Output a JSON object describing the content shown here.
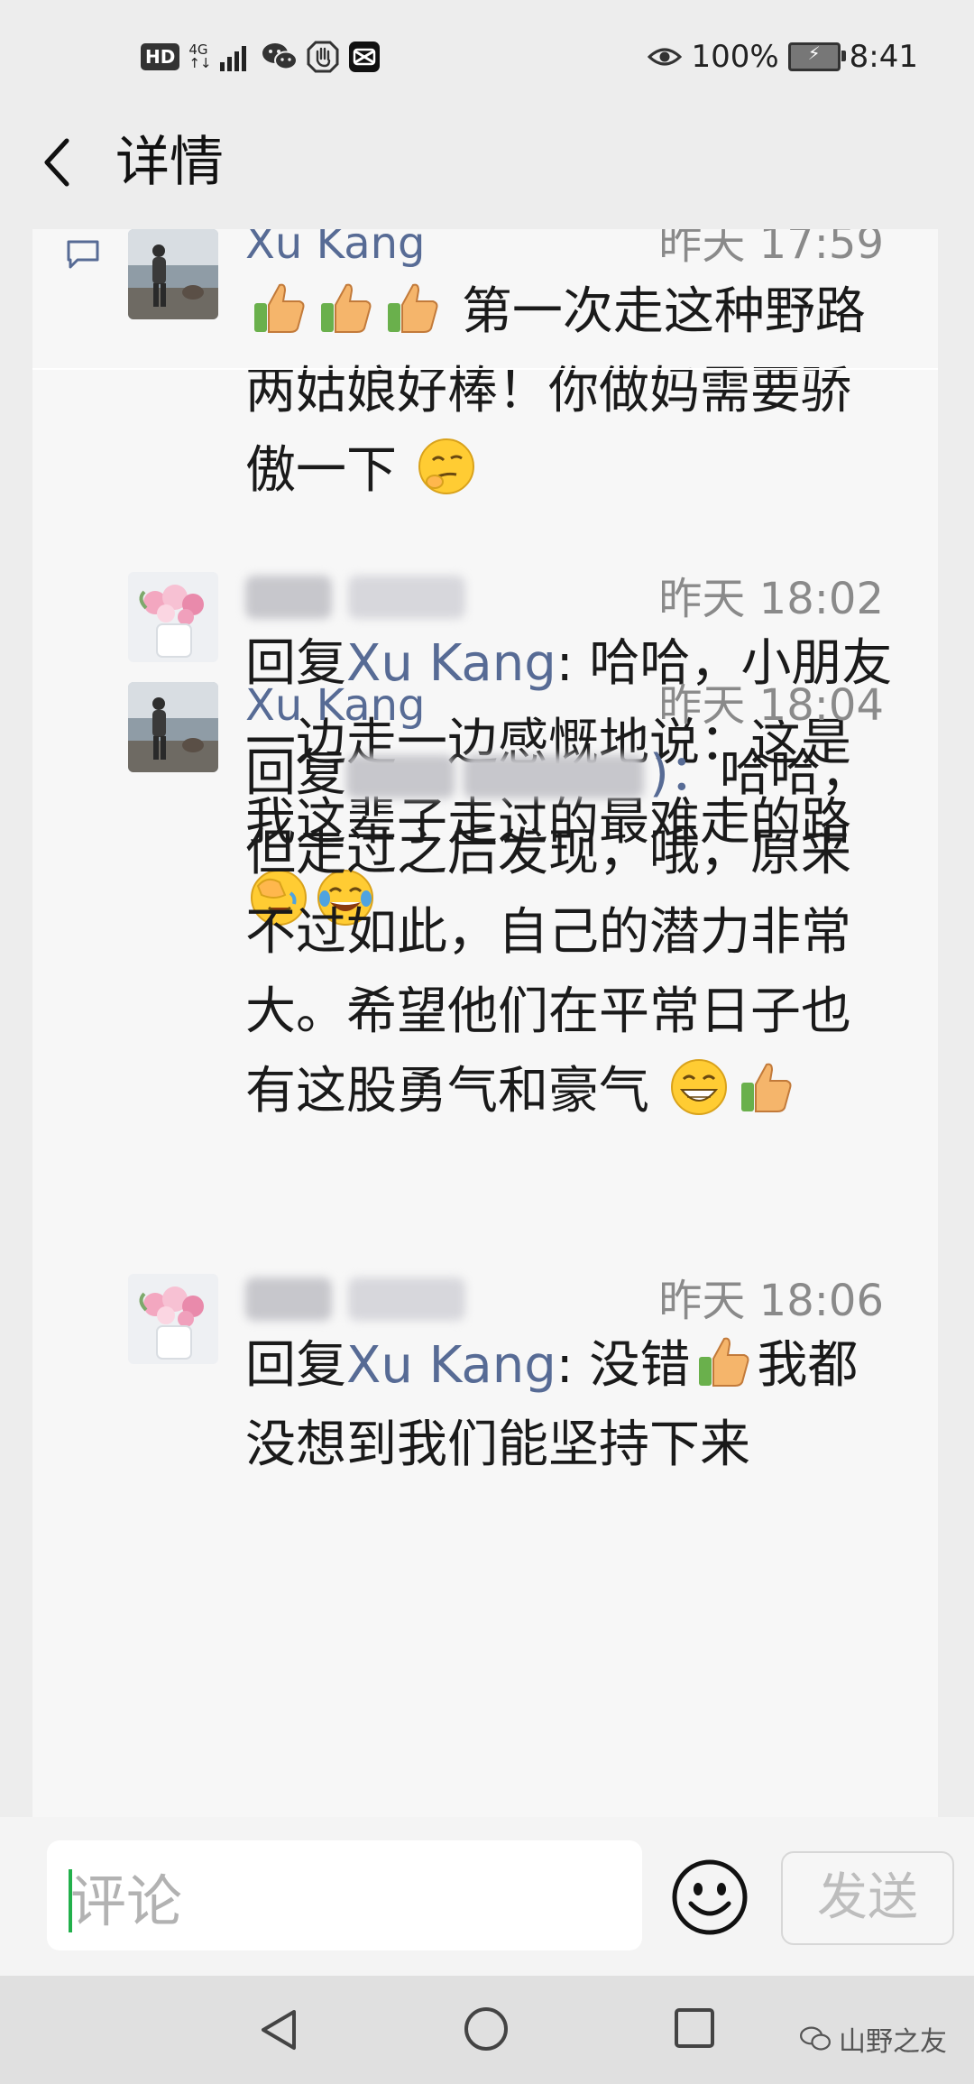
{
  "status_bar": {
    "left_icons": [
      "HD",
      "4G",
      "signal-icon",
      "wechat-icon",
      "hand-icon",
      "capcut-icon"
    ],
    "hd_label": "HD",
    "net_top": "4G",
    "net_bottom": "↑↓",
    "battery_percent": "100%",
    "time": "8:41"
  },
  "header": {
    "title": "详情",
    "back_icon": "chevron-left-icon"
  },
  "comments": [
    {
      "name": "Xu Kang",
      "name_blurred": false,
      "time": "昨天 17:59",
      "avatar": "person-by-lake",
      "text_before": "",
      "reply_to": "",
      "text": "第一次走这种野路两姑娘好棒！你做妈需要骄傲一下",
      "emojis_leading": [
        "thumbs-up",
        "thumbs-up",
        "thumbs-up"
      ],
      "emojis_trailing": [
        "smirk"
      ]
    },
    {
      "name": "",
      "name_blurred": true,
      "time": "昨天 18:02",
      "avatar": "flowers",
      "reply_prefix": "回复",
      "reply_to": "Xu Kang",
      "text": ": 哈哈，小朋友一边走一边感慨地说：这是我这辈子走过的最难走的路",
      "emojis_trailing": [
        "facepalm",
        "tears-of-joy"
      ]
    },
    {
      "name": "Xu Kang",
      "name_blurred": false,
      "time": "昨天 18:04",
      "avatar": "person-by-lake",
      "reply_prefix": "回复",
      "reply_to_blurred": true,
      "reply_suffix": ")：",
      "text": "哈哈，但走过之后发现，哦，原来不过如此，自己的潜力非常大。希望他们在平常日子也有这股勇气和豪气",
      "emojis_trailing": [
        "grin",
        "thumbs-up"
      ]
    },
    {
      "name": "",
      "name_blurred": true,
      "time": "昨天 18:06",
      "avatar": "flowers",
      "reply_prefix": "回复",
      "reply_to": "Xu Kang",
      "text_a": ": 没错",
      "text_b": "我都没想到我们能坚持下来",
      "emojis_inline": [
        "thumbs-up"
      ]
    }
  ],
  "input_bar": {
    "placeholder": "评论",
    "emoji_button": "smile-icon",
    "send_label": "发送"
  },
  "system_nav": {
    "buttons": [
      "back-triangle-icon",
      "home-circle-icon",
      "recent-square-icon"
    ],
    "watermark": "山野之友"
  },
  "colors": {
    "link": "#576b95",
    "background": "#ededed",
    "card": "#f7f7f7",
    "caret": "#22b04b"
  }
}
